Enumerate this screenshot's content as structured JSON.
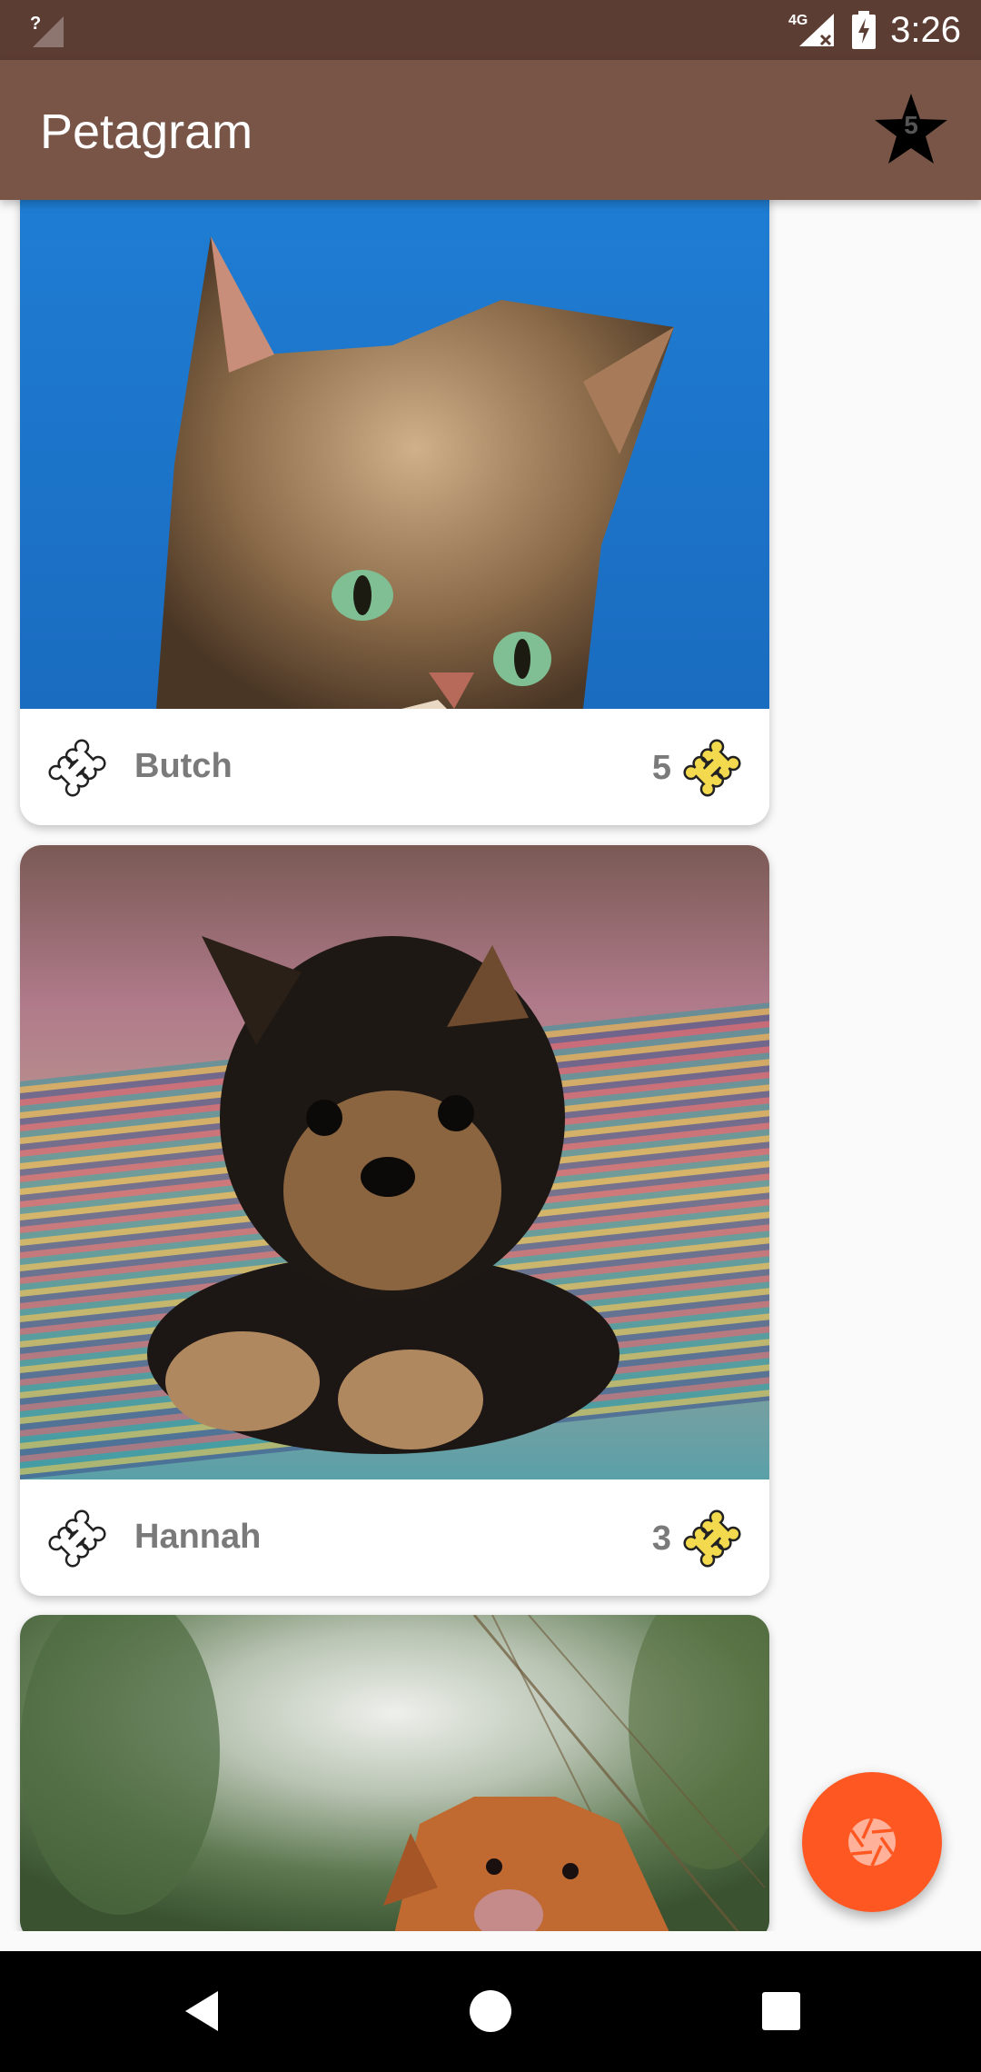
{
  "status_bar": {
    "time": "3:26",
    "network_label": "4G",
    "icons": [
      "signal-unknown-icon",
      "network-4g-icon",
      "battery-charging-icon"
    ]
  },
  "app_bar": {
    "title": "Petagram",
    "favorites_count": "5",
    "icons": [
      "star-icon"
    ]
  },
  "feed": {
    "pets": [
      {
        "name": "Butch",
        "rating": "5",
        "photo": "tabby-cat-photo"
      },
      {
        "name": "Hannah",
        "rating": "3",
        "photo": "yorkshire-puppy-photo"
      },
      {
        "name": "",
        "rating": "",
        "photo": "golden-retriever-photo"
      }
    ],
    "icons": [
      "bone-outline-icon",
      "bone-filled-icon"
    ]
  },
  "fab": {
    "icon": "camera-shutter-icon",
    "color": "#FF5722"
  },
  "navigation": {
    "icons": [
      "back-icon",
      "home-icon",
      "recents-icon"
    ]
  },
  "colors": {
    "primary": "#795548",
    "primary_dark": "#5C3D33",
    "accent": "#FF5722",
    "bone_yellow": "#F2D94E",
    "text_gray": "#7A7A7A"
  }
}
